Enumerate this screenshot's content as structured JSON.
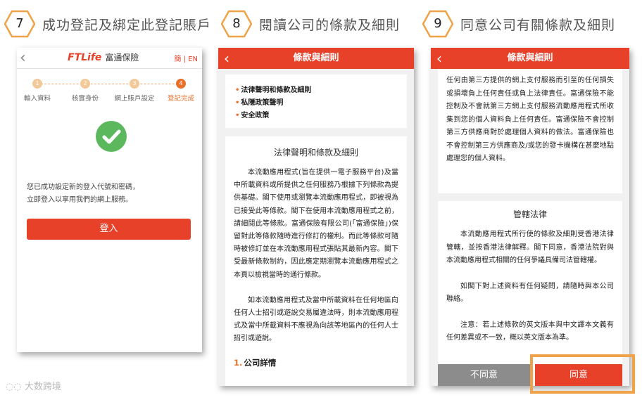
{
  "steps": [
    {
      "number": "7",
      "title": "成功登記及綁定此登記賬戶"
    },
    {
      "number": "8",
      "title": "閱讀公司的條款及細則"
    },
    {
      "number": "9",
      "title": "同意公司有關條款及細則"
    }
  ],
  "panel1": {
    "back_icon": "chevron-left-icon",
    "logo_brand": "FTLife",
    "logo_cn": "富通保險",
    "lang": "簡 | EN",
    "progress": [
      {
        "num": "1",
        "label": "輸入資料"
      },
      {
        "num": "2",
        "label": "核實身份"
      },
      {
        "num": "3",
        "label": "網上賬戶設定"
      },
      {
        "num": "4",
        "label": "登記完成"
      }
    ],
    "success_icon": "checkmark-circle-icon",
    "message_line1": "您已成功設定新的登入代號和密碼，",
    "message_line2": "立即登入以享用我們的網上服務。",
    "login_label": "登入",
    "colors": {
      "brand": "#e8412a",
      "success": "#5cb85c"
    }
  },
  "panel2": {
    "header_title": "條款與細則",
    "links": [
      "法律聲明和條款及細則",
      "私隱政策聲明",
      "安全政策"
    ],
    "doc_title": "法律聲明和條款及細則",
    "para1": "本流動應用程式(旨在提供一電子服務平台)及當中所載資料或所提供之任何服務乃根據下列條款為提供基礎。閣下使用或瀏覽本流動應用程式，即被視為已接受此等條款。閣下在使用本流動應用程式之前，請細閱此等條款。富通保險有限公司(「富通保險」)保留對此等條款隨時進行修訂的權利。而此等條款可隨時被修訂並在本流動應用程式張貼其最新內容。閣下受最新條款制約，因此應定期瀏覽本流動應用程式之本頁以檢視當時的通行條款。",
    "para2": "如本流動應用程式及當中所載資料在任何地區向任何人士招引或遊說交易屬違法時，則本流動應用程式及當中所載資料不應視為向該等地區內的任何人士招引或遊說。",
    "section_num": "1.",
    "section_title": "公司詳情"
  },
  "panel3": {
    "header_title": "條款與細則",
    "top_para": "任何由第三方提供的網上支付服務而引至的任何損失或損壞負上任何責任或負上法律責任。富通保險不能控制及不會就第三方網上支付服務流動應用程式所收集到您的個人資料負上任何責任。富通保險不會控制第三方供應商對於處理個人資料的做法。富通保險也不會控制第三方供應商及/或您的發卡機構在甚麼地點處理您的個人資料。",
    "law_title": "管轄法律",
    "law_para": "本流動應用程式所行使的條款及細則受香港法律管轄，並按香港法律解釋。閣下同意，香港法院對與本流動應用程式相關的任何爭議具備司法管轄權。",
    "contact_para": "如閣下對上述資料有任何疑問，請隨時與本公司聯絡。",
    "note_para": "注意：若上述條款的英文版本與中文譯本文義有任何差異或不一致，概以英文版本為準。",
    "disagree_label": "不同意",
    "agree_label": "同意",
    "highlight_color": "#f0a248"
  },
  "watermark": "大数跨境"
}
